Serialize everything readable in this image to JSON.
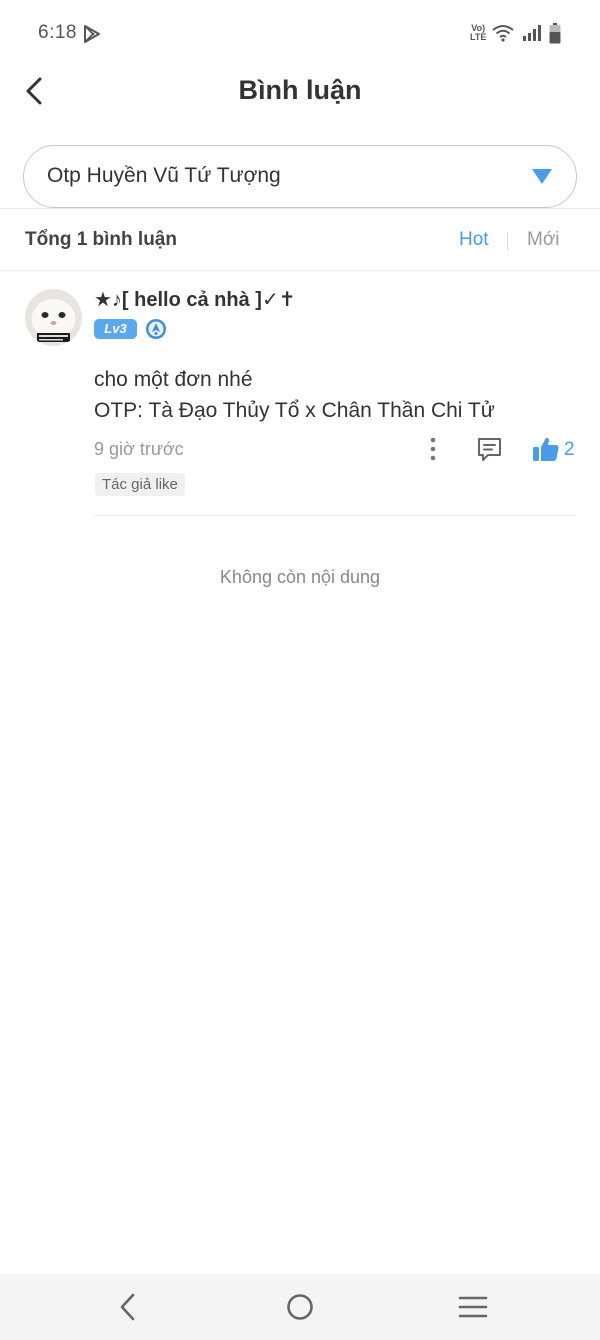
{
  "status_bar": {
    "time": "6:18",
    "network_top": "Vo)",
    "network_bottom": "LTE"
  },
  "header": {
    "title": "Bình luận"
  },
  "story_select": {
    "selected": "Otp Huyền Vũ Tứ Tượng"
  },
  "comments_header": {
    "total": "Tổng 1 bình luận",
    "sort_hot": "Hot",
    "sort_new": "Mới"
  },
  "comment": {
    "username": "★♪[ hello cả nhà ]✓✝",
    "level": "Lv3",
    "lines": [
      "cho một đơn nhé",
      "OTP: Tà Đạo Thủy Tổ x Chân Thần Chi Tử"
    ],
    "time": "9 giờ trước",
    "likes": "2",
    "author_like": "Tác giả like"
  },
  "footer": {
    "no_more": "Không còn nội dung"
  },
  "colors": {
    "accent": "#4a9be8",
    "badge": "#5aa8f0"
  }
}
